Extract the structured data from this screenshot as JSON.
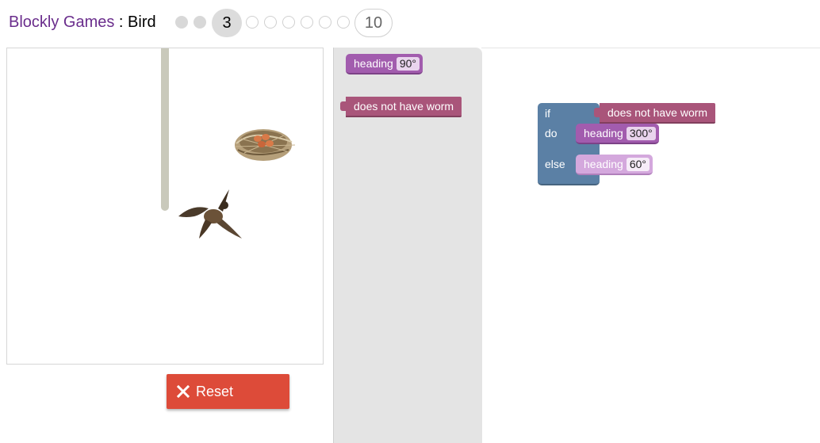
{
  "header": {
    "app_name": "Blockly Games",
    "separator": " : ",
    "game_name": "Bird",
    "current_level": "3",
    "last_level": "10"
  },
  "game": {
    "nest_icon": "nest-with-eggs",
    "bird_icon": "flying-bird"
  },
  "controls": {
    "reset_label": "Reset",
    "reset_icon": "x-icon",
    "reset_color": "#dd4b39"
  },
  "toolbox": {
    "heading_label": "heading",
    "heading_value": "90°",
    "worm_label": "does not have worm"
  },
  "workspace": {
    "if_label": "if",
    "do_label": "do",
    "else_label": "else",
    "condition_label": "does not have worm",
    "do_heading_label": "heading",
    "do_heading_value": "300°",
    "else_heading_label": "heading",
    "else_heading_value": "60°"
  },
  "colors": {
    "heading_block": "#a25cae",
    "worm_block": "#a9557a",
    "if_block": "#5b80a5",
    "title_link": "#6a2d8c"
  }
}
